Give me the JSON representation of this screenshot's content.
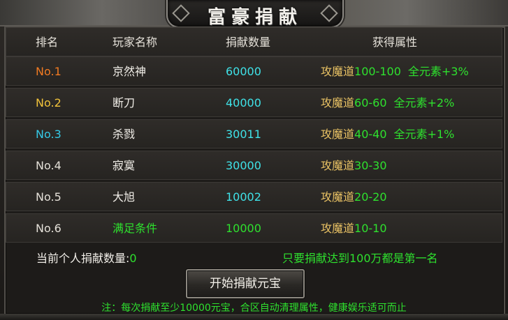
{
  "window": {
    "title": "富豪捐献"
  },
  "table": {
    "headers": [
      "排名",
      "玩家名称",
      "捐献数量",
      "获得属性"
    ],
    "rows": [
      {
        "rank": "No.1",
        "name": "京然神",
        "amount": "60000",
        "attr_label": "攻魔道",
        "attr_value": "100-100",
        "bonus": "全元素+3%"
      },
      {
        "rank": "No.2",
        "name": "断刀",
        "amount": "40000",
        "attr_label": "攻魔道",
        "attr_value": "60-60",
        "bonus": "全元素+2%"
      },
      {
        "rank": "No.3",
        "name": "杀戮",
        "amount": "30011",
        "attr_label": "攻魔道",
        "attr_value": "40-40",
        "bonus": "全元素+1%"
      },
      {
        "rank": "No.4",
        "name": "寂寞",
        "amount": "30000",
        "attr_label": "攻魔道",
        "attr_value": "30-30",
        "bonus": ""
      },
      {
        "rank": "No.5",
        "name": "大旭",
        "amount": "10002",
        "attr_label": "攻魔道",
        "attr_value": "20-20",
        "bonus": ""
      },
      {
        "rank": "No.6",
        "name": "满足条件",
        "amount": "10000",
        "attr_label": "攻魔道",
        "attr_value": "10-10",
        "bonus": ""
      }
    ]
  },
  "footer": {
    "current_label": "当前个人捐献数量:",
    "current_value": "0",
    "hint": "只要捐献达到100万都是第一名",
    "donate_button": "开始捐献元宝",
    "note": "注：每次捐献至少10000元宝，合区自动清理属性，健康娱乐适可而止"
  },
  "colors": {
    "rank1": "#f07a22",
    "rank2": "#f2c33a",
    "rank3": "#35c9e6",
    "rank_other": "#e4e0d8",
    "attr_label": "#e9c264",
    "attr_value": "#2ee12e",
    "amount": "#3fe2e8"
  }
}
